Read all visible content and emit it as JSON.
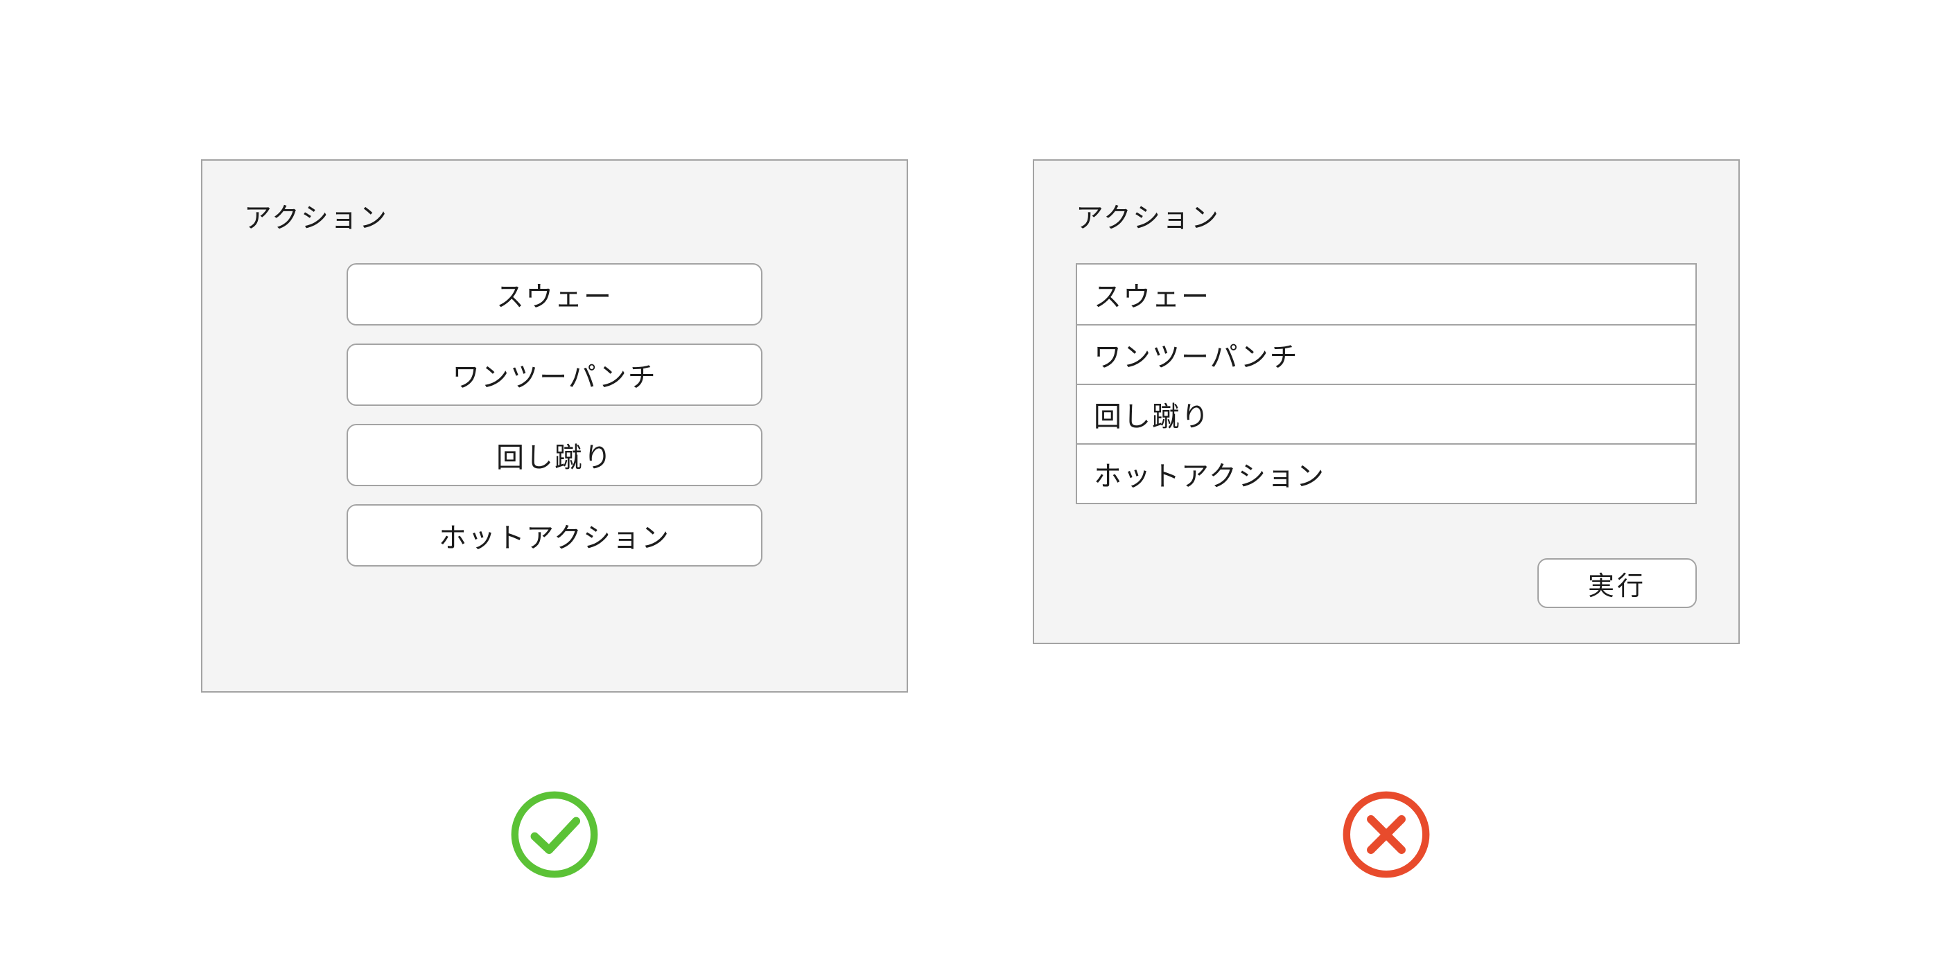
{
  "good_panel": {
    "title": "アクション",
    "actions": [
      "スウェー",
      "ワンツーパンチ",
      "回し蹴り",
      "ホットアクション"
    ]
  },
  "bad_panel": {
    "title": "アクション",
    "actions": [
      "スウェー",
      "ワンツーパンチ",
      "回し蹴り",
      "ホットアクション"
    ],
    "execute_label": "実行"
  },
  "colors": {
    "success": "#5bc236",
    "error": "#e84b2c",
    "panel_bg": "#f4f4f4",
    "border": "#a3a3a3"
  }
}
